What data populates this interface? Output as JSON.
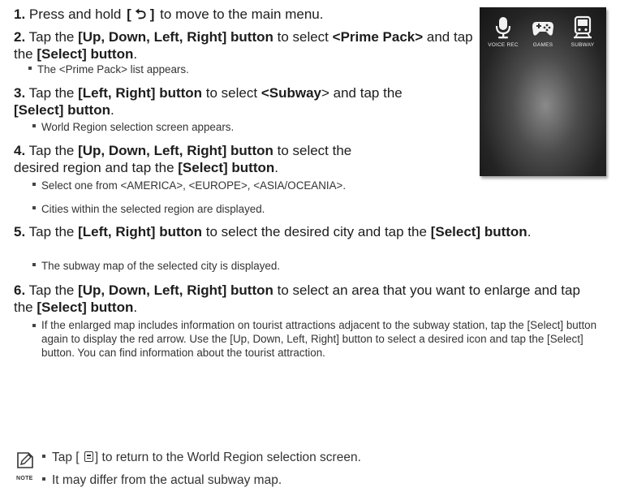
{
  "steps": [
    {
      "num": "1.",
      "pre": "Press and hold ",
      "key": "[ ⮌ ]",
      "post": " to move to the main menu."
    },
    {
      "num": "2.",
      "pre": "Tap the ",
      "b1": "[Up, Down, Left, Right] button",
      "mid": " to select ",
      "b2": "<Prime Pack>",
      "mid2": " and tap the ",
      "b3": "[Select] button",
      "post": "."
    },
    {
      "num": "3.",
      "pre": "Tap the ",
      "b1": "[Left, Right] button",
      "mid": " to select ",
      "b2": "<Subway",
      "mid2": "> and tap the ",
      "b3": "[Select] button",
      "post": "."
    },
    {
      "num": "4.",
      "pre": "Tap the ",
      "b1": "[Up, Down, Left, Right] button",
      "mid": " to select the desired region and tap the ",
      "b3": "[Select] button",
      "post": "."
    },
    {
      "num": "5.",
      "pre": "Tap the ",
      "b1": "[Left, Right] button",
      "mid": " to select the desired city and tap the ",
      "b3": "[Select] button",
      "post": "."
    },
    {
      "num": "6.",
      "pre": "Tap the ",
      "b1": "[Up, Down, Left, Right] button",
      "mid": " to select an area that you want to enlarge and tap the ",
      "b3": "[Select] button",
      "post": "."
    }
  ],
  "subs": {
    "s2": "The <Prime Pack> list appears.",
    "s3": "World Region selection screen appears.",
    "s4a": "Select one from <AMERICA>, <EUROPE>, <ASIA/OCEANIA>.",
    "s4b": "Cities within the selected region are displayed.",
    "s5": "The subway map of the selected city is displayed.",
    "s6": "If the enlarged map includes information on tourist attractions adjacent to the subway station, tap the [Select] button again to display the red arrow. Use the [Up, Down, Left, Right] button to select a desired icon and tap the [Select] button. You can find information about the tourist attraction."
  },
  "screen": {
    "apps": [
      {
        "label": "VOICE REC",
        "icon": "microphone-icon"
      },
      {
        "label": "GAMES",
        "icon": "gamepad-icon"
      },
      {
        "label": "SUBWAY",
        "icon": "train-icon"
      }
    ]
  },
  "note": {
    "label": "NOTE",
    "item1_pre": "Tap [",
    "item1_post": "] to return to the World Region selection screen.",
    "item2": "It may differ from the actual subway map."
  }
}
